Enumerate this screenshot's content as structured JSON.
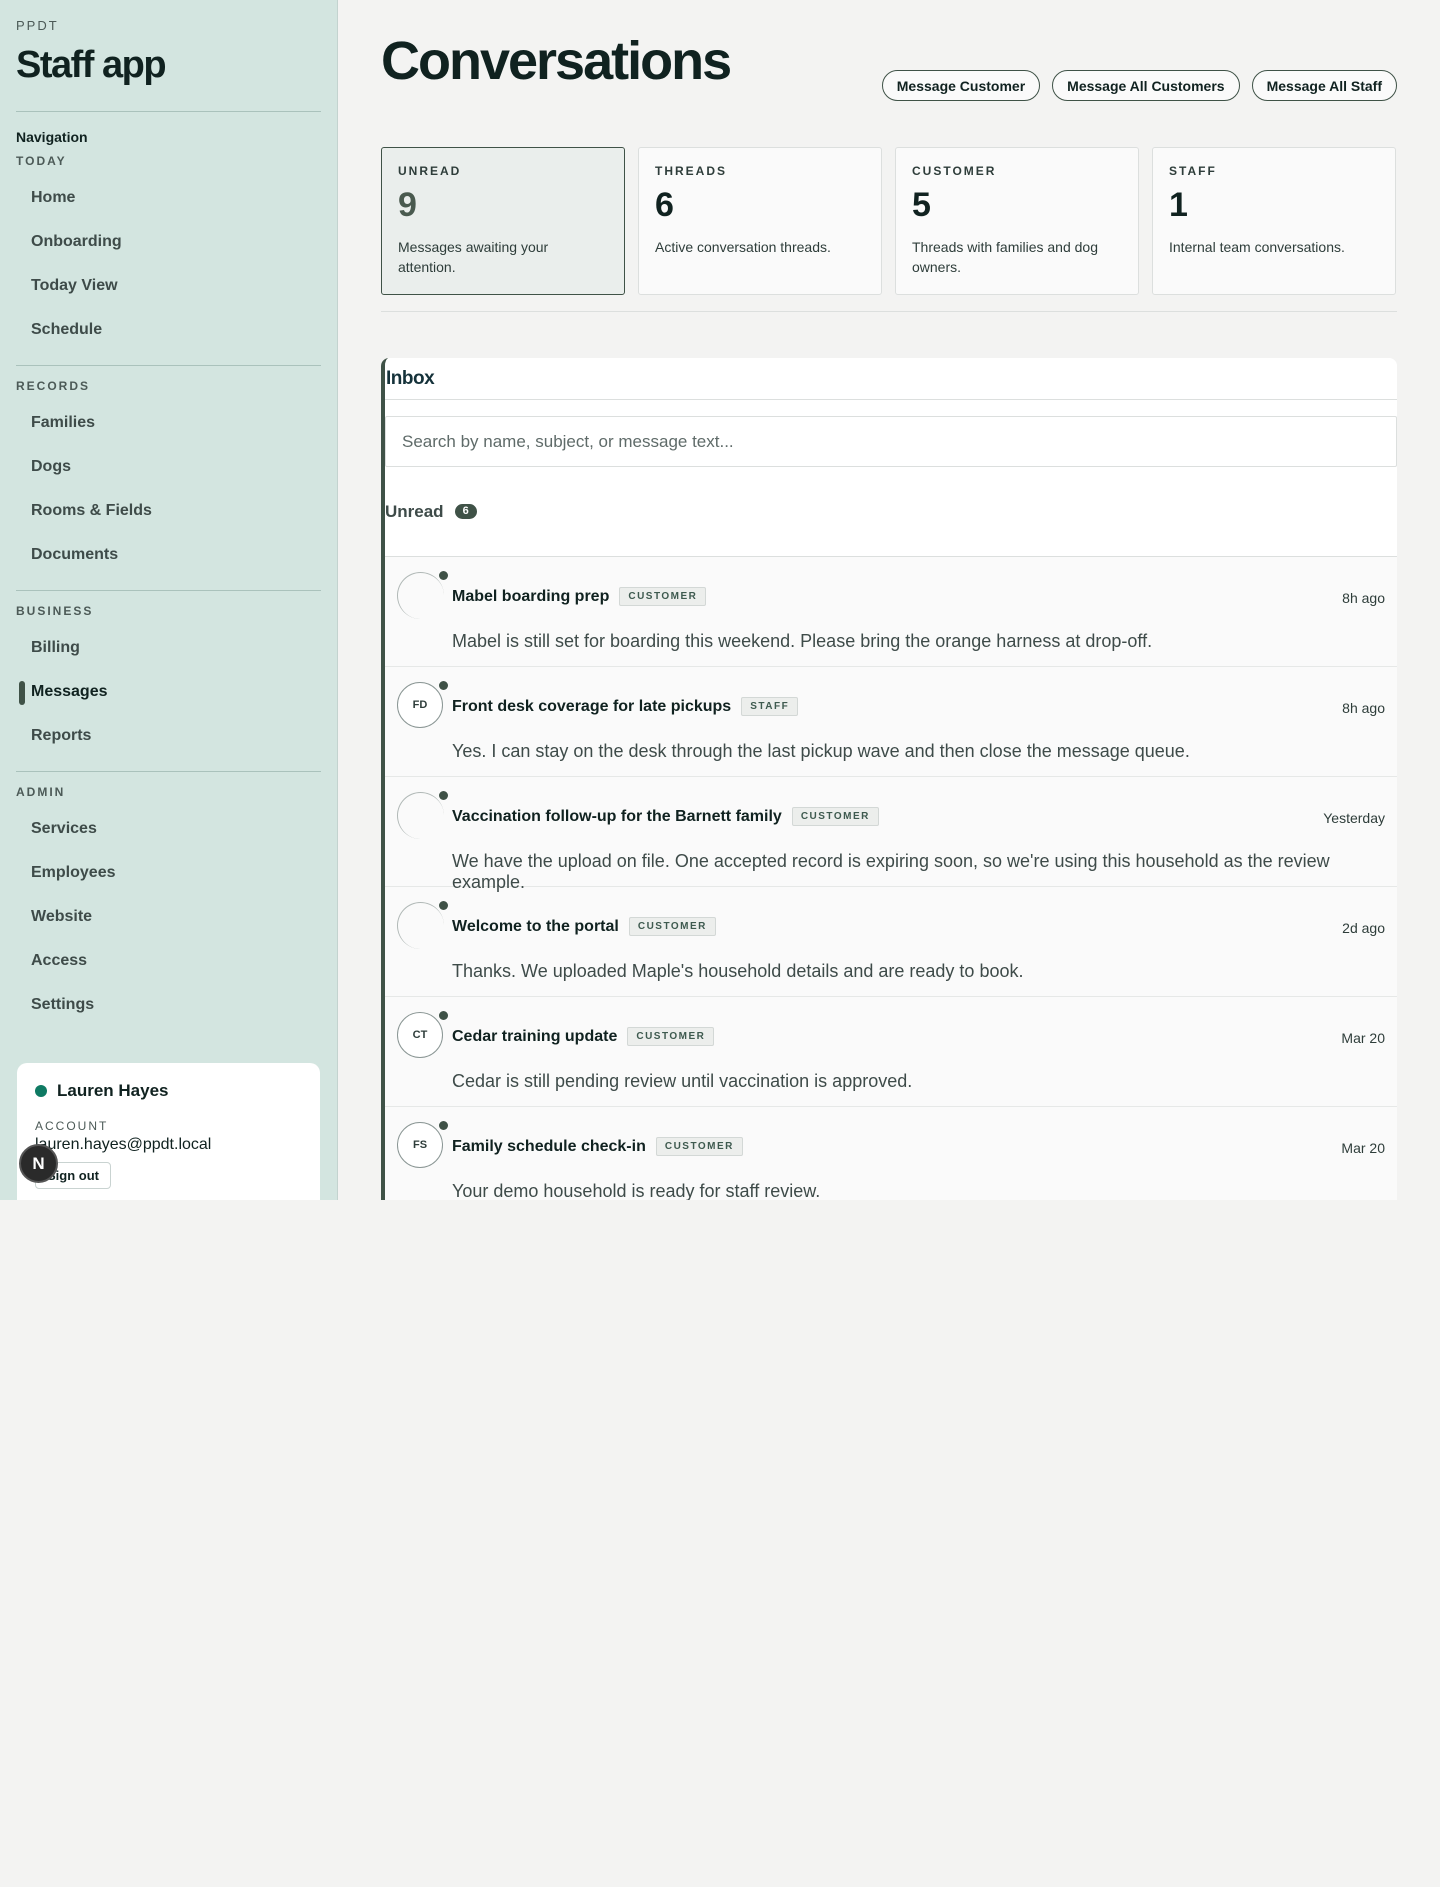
{
  "sidebar": {
    "eyebrow": "PPDT",
    "title": "Staff app",
    "nav_heading": "Navigation",
    "sections": [
      {
        "label": "TODAY",
        "items": [
          "Home",
          "Onboarding",
          "Today View",
          "Schedule"
        ]
      },
      {
        "label": "RECORDS",
        "items": [
          "Families",
          "Dogs",
          "Rooms & Fields",
          "Documents"
        ]
      },
      {
        "label": "BUSINESS",
        "items": [
          "Billing",
          "Messages",
          "Reports"
        ]
      },
      {
        "label": "ADMIN",
        "items": [
          "Services",
          "Employees",
          "Website",
          "Access",
          "Settings"
        ]
      }
    ],
    "active_item": "Messages",
    "account": {
      "name": "Lauren Hayes",
      "label": "ACCOUNT",
      "email": "lauren.hayes@ppdt.local",
      "sign_out": "Sign out",
      "status_color": "#0f7a63"
    },
    "floating_badge": "N"
  },
  "header": {
    "title": "Conversations",
    "actions": [
      "Message Customer",
      "Message All Customers",
      "Message All Staff"
    ]
  },
  "stats": [
    {
      "label": "UNREAD",
      "value": "9",
      "desc": "Messages awaiting your attention.",
      "highlight": true
    },
    {
      "label": "THREADS",
      "value": "6",
      "desc": "Active conversation threads."
    },
    {
      "label": "CUSTOMER",
      "value": "5",
      "desc": "Threads with families and dog owners."
    },
    {
      "label": "STAFF",
      "value": "1",
      "desc": "Internal team conversations."
    }
  ],
  "inbox": {
    "title": "Inbox",
    "search_placeholder": "Search by name, subject, or message text...",
    "unread_label": "Unread",
    "unread_count": "6",
    "messages": [
      {
        "avatar": "",
        "subject": "Mabel boarding prep",
        "tag": "CUSTOMER",
        "time": "8h ago",
        "body": "Mabel is still set for boarding this weekend. Please bring the orange harness at drop-off."
      },
      {
        "avatar": "FD",
        "subject": "Front desk coverage for late pickups",
        "tag": "STAFF",
        "time": "8h ago",
        "body": "Yes. I can stay on the desk through the last pickup wave and then close the message queue."
      },
      {
        "avatar": "",
        "subject": "Vaccination follow-up for the Barnett family",
        "tag": "CUSTOMER",
        "time": "Yesterday",
        "body": "We have the upload on file. One accepted record is expiring soon, so we're using this household as the review example."
      },
      {
        "avatar": "",
        "subject": "Welcome to the portal",
        "tag": "CUSTOMER",
        "time": "2d ago",
        "body": "Thanks. We uploaded Maple's household details and are ready to book."
      },
      {
        "avatar": "CT",
        "subject": "Cedar training update",
        "tag": "CUSTOMER",
        "time": "Mar 20",
        "body": "Cedar is still pending review until vaccination is approved."
      },
      {
        "avatar": "FS",
        "subject": "Family schedule check-in",
        "tag": "CUSTOMER",
        "time": "Mar 20",
        "body": "Your demo household is ready for staff review."
      }
    ]
  },
  "colors": {
    "sidebar_bg": "#d3e5e0",
    "accent": "#3f5247",
    "page_bg": "#f3f3f2"
  }
}
